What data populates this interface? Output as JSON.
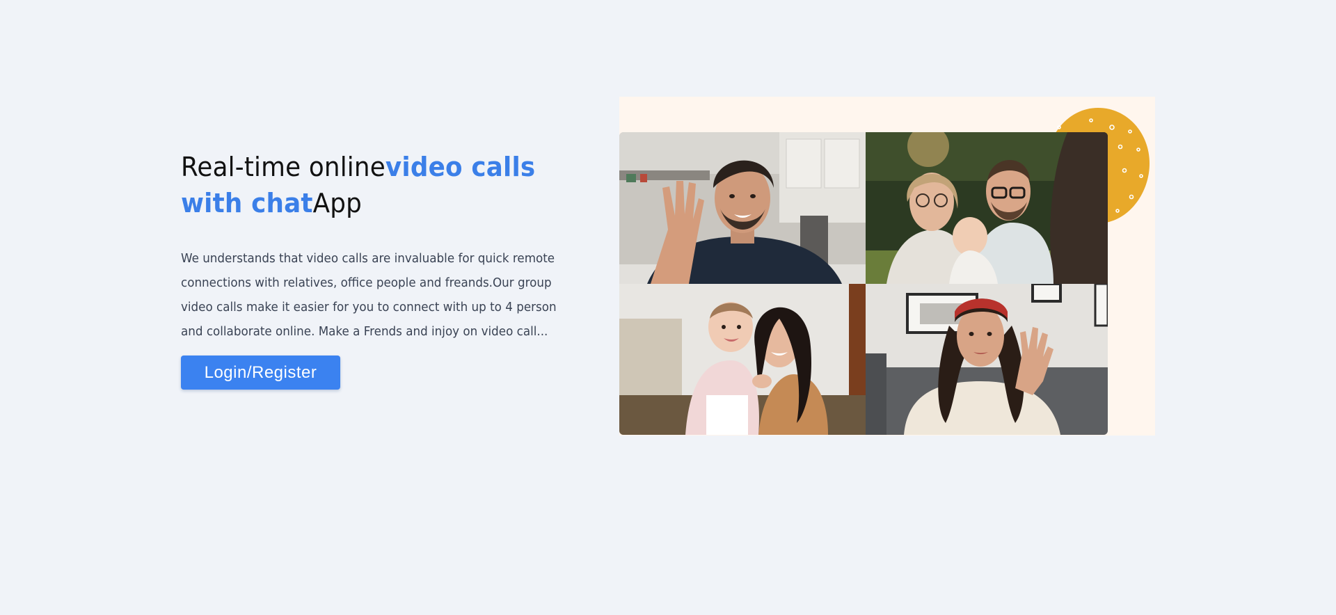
{
  "hero": {
    "headline": {
      "part1": "Real-time online",
      "accent": "video calls with chat",
      "part2": "App"
    },
    "description": "We understands that video calls are invaluable for quick remote connections with relatives, office people and freands.Our group video calls make it easier for you to connect with up to 4 person and collaborate online. Make a Frends and injoy on video call...",
    "login_button": "Login/Register"
  },
  "illustration": {
    "tiles": [
      {
        "name": "video-tile-man-waving"
      },
      {
        "name": "video-tile-family"
      },
      {
        "name": "video-tile-mother-baby"
      },
      {
        "name": "video-tile-woman-waving"
      }
    ]
  },
  "colors": {
    "background": "#f0f3f8",
    "accent": "#3b7fe8",
    "button": "#3b82f0",
    "illustration_bg": "#fff6ee",
    "blob": "#e8a92a"
  }
}
